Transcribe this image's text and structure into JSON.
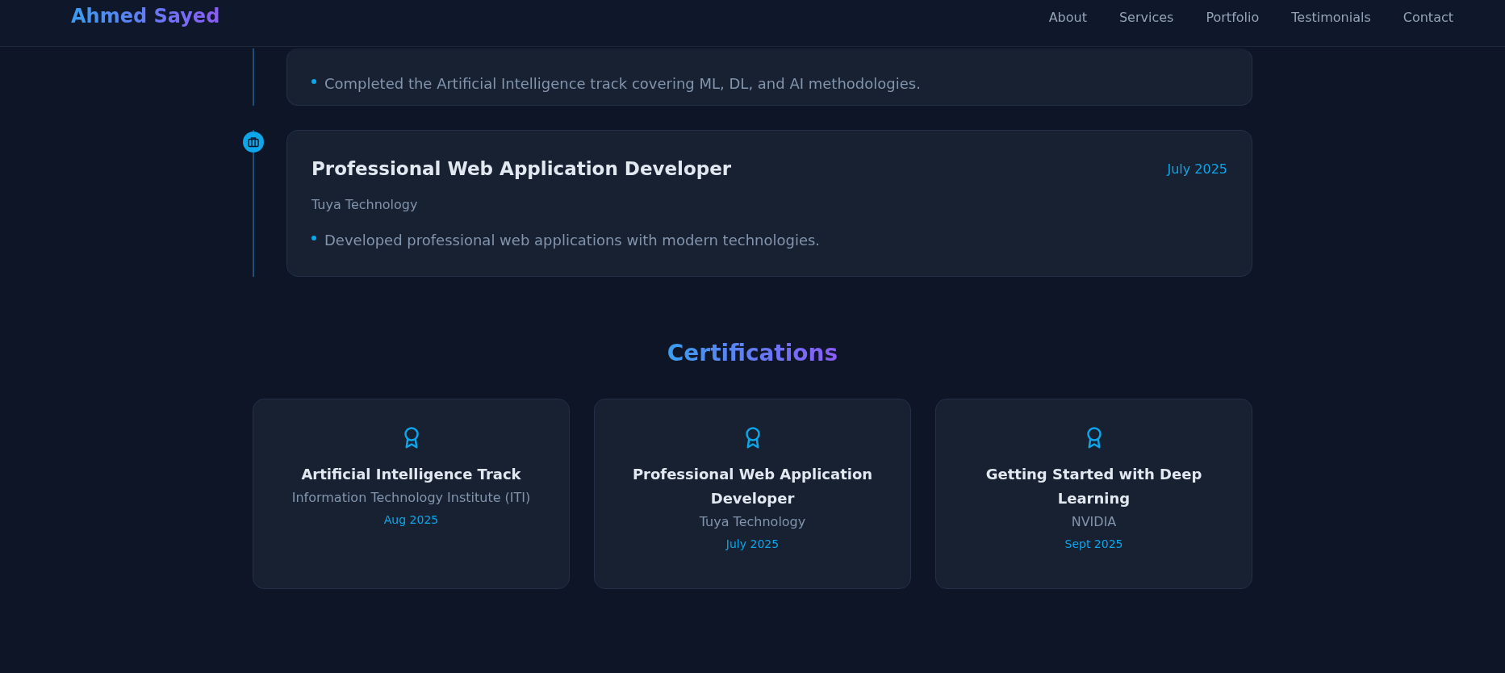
{
  "header": {
    "logo": "Ahmed Sayed",
    "nav": [
      "About",
      "Services",
      "Portfolio",
      "Testimonials",
      "Contact"
    ]
  },
  "experience": [
    {
      "bullets": [
        "Completed the Artificial Intelligence track covering ML, DL, and AI methodologies."
      ]
    },
    {
      "title": "Professional Web Application Developer",
      "date": "July 2025",
      "company": "Tuya Technology",
      "bullets": [
        "Developed professional web applications with modern technologies."
      ]
    }
  ],
  "certifications": {
    "title": "Certifications",
    "items": [
      {
        "name": "Artificial Intelligence Track",
        "issuer": "Information Technology Institute (ITI)",
        "date": "Aug 2025"
      },
      {
        "name": "Professional Web Application Developer",
        "issuer": "Tuya Technology",
        "date": "July 2025"
      },
      {
        "name": "Getting Started with Deep Learning",
        "issuer": "NVIDIA",
        "date": "Sept 2025"
      }
    ]
  }
}
